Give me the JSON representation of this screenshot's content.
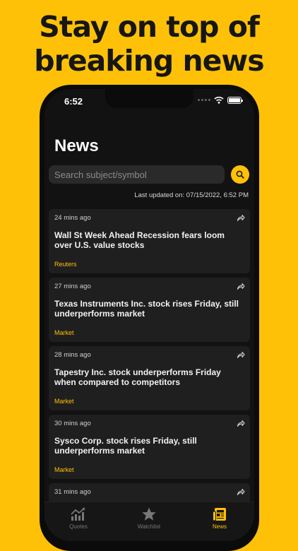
{
  "headline": [
    "Stay on top of",
    "breaking news"
  ],
  "status": {
    "time": "6:52"
  },
  "page": {
    "title": "News"
  },
  "search": {
    "placeholder": "Search subject/symbol"
  },
  "last_updated": "Last updated on: 07/15/2022, 6:52 PM",
  "news": [
    {
      "time": "24 mins ago",
      "title": "Wall St Week Ahead Recession fears loom over U.S. value stocks",
      "source": "Reuters"
    },
    {
      "time": "27 mins ago",
      "title": "Texas Instruments Inc. stock rises Friday, still underperforms market",
      "source": "Market"
    },
    {
      "time": "28 mins ago",
      "title": "Tapestry Inc. stock underperforms Friday when compared to competitors",
      "source": "Market"
    },
    {
      "time": "30 mins ago",
      "title": "Sysco Corp. stock rises Friday, still underperforms market",
      "source": "Market"
    },
    {
      "time": "31 mins ago",
      "title": "",
      "source": ""
    }
  ],
  "tabs": [
    {
      "label": "Quotes",
      "icon": "chart-icon",
      "active": false
    },
    {
      "label": "Watchlist",
      "icon": "star-icon",
      "active": false
    },
    {
      "label": "News",
      "icon": "newspaper-icon",
      "active": true
    }
  ],
  "colors": {
    "accent": "#FFC107",
    "background": "#121212",
    "card": "#1f1f1f"
  }
}
